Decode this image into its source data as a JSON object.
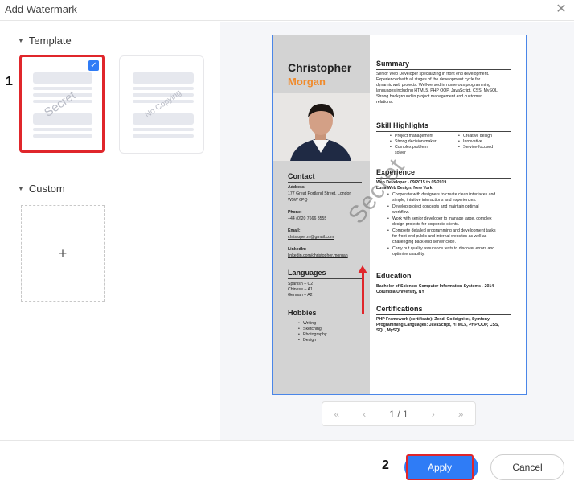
{
  "window": {
    "title": "Add Watermark"
  },
  "template_section": {
    "label": "Template",
    "items": [
      {
        "watermark": "Secret",
        "selected": true
      },
      {
        "watermark": "No Copying",
        "selected": false
      }
    ]
  },
  "custom_section": {
    "label": "Custom",
    "add_symbol": "+"
  },
  "steps": {
    "one": "1",
    "two": "2"
  },
  "preview": {
    "name_first": "Christopher",
    "name_last": "Morgan",
    "watermark": "Secret",
    "contact": {
      "heading": "Contact",
      "address_label": "Address:",
      "address_1": "177 Great Portland Street, London",
      "address_2": "W5W 6PQ",
      "phone_label": "Phone:",
      "phone": "+44 (0)20 7666 8555",
      "email_label": "Email:",
      "email": "christoper.m@gmail.com",
      "linkedin_label": "LinkedIn:",
      "linkedin": "linkedin.com/christopher.morgan"
    },
    "languages": {
      "heading": "Languages",
      "items": [
        "Spanish – C2",
        "Chinese – A1",
        "German – A2"
      ]
    },
    "hobbies": {
      "heading": "Hobbies",
      "items": [
        "Writing",
        "Sketching",
        "Photography",
        "Design"
      ]
    },
    "summary": {
      "heading": "Summary",
      "lines": [
        "Senior Web Developer specializing in front end development.",
        "Experienced with all stages of the development cycle for",
        "dynamic web projects. Well-versed in numerous programming",
        "languages including HTML5, PHP OOP, JavaScript, CSS, MySQL.",
        "Strong background in project management and customer",
        "relations."
      ]
    },
    "skills": {
      "heading": "Skill Highlights",
      "col1": [
        "Project management",
        "Strong decision maker",
        "Complex problem",
        "solver"
      ],
      "col2": [
        "Creative design",
        "Innovative",
        "Service-focused"
      ]
    },
    "experience": {
      "heading": "Experience",
      "role": "Web Developer - 09/2015 to 05/2019",
      "company": "Luna Web Design, New York",
      "bullets": [
        "Cooperate with designers to create clean interfaces and",
        "simple, intuitive interactions and experiences.",
        "Develop project concepts and maintain optimal",
        "workflow.",
        "Work with senior developer to manage large, complex",
        "design projects for corporate clients.",
        "Complete detailed programming and development tasks",
        "for front end public and internal websites as well as",
        "challenging back-end server code.",
        "Carry out quality assurance tests to discover errors and",
        "optimize usability."
      ]
    },
    "education": {
      "heading": "Education",
      "line1": "Bachelor of Science: Computer Information Systems - 2014",
      "line2": "Columbia University, NY"
    },
    "certifications": {
      "heading": "Certifications",
      "line1": "PHP Framework (certificate): Zend, Codeigniter, Symfony.",
      "line2": "Programming Languages: JavaScript, HTML5, PHP OOP, CSS,",
      "line3": "SQL, MySQL."
    }
  },
  "pager": {
    "first": "«",
    "prev": "‹",
    "page": "1 / 1",
    "next": "›",
    "last": "»"
  },
  "footer": {
    "apply": "Apply",
    "cancel": "Cancel"
  },
  "colors": {
    "accent": "#2f7cf6",
    "highlight": "#e0262b",
    "name_orange": "#f08a2b"
  }
}
